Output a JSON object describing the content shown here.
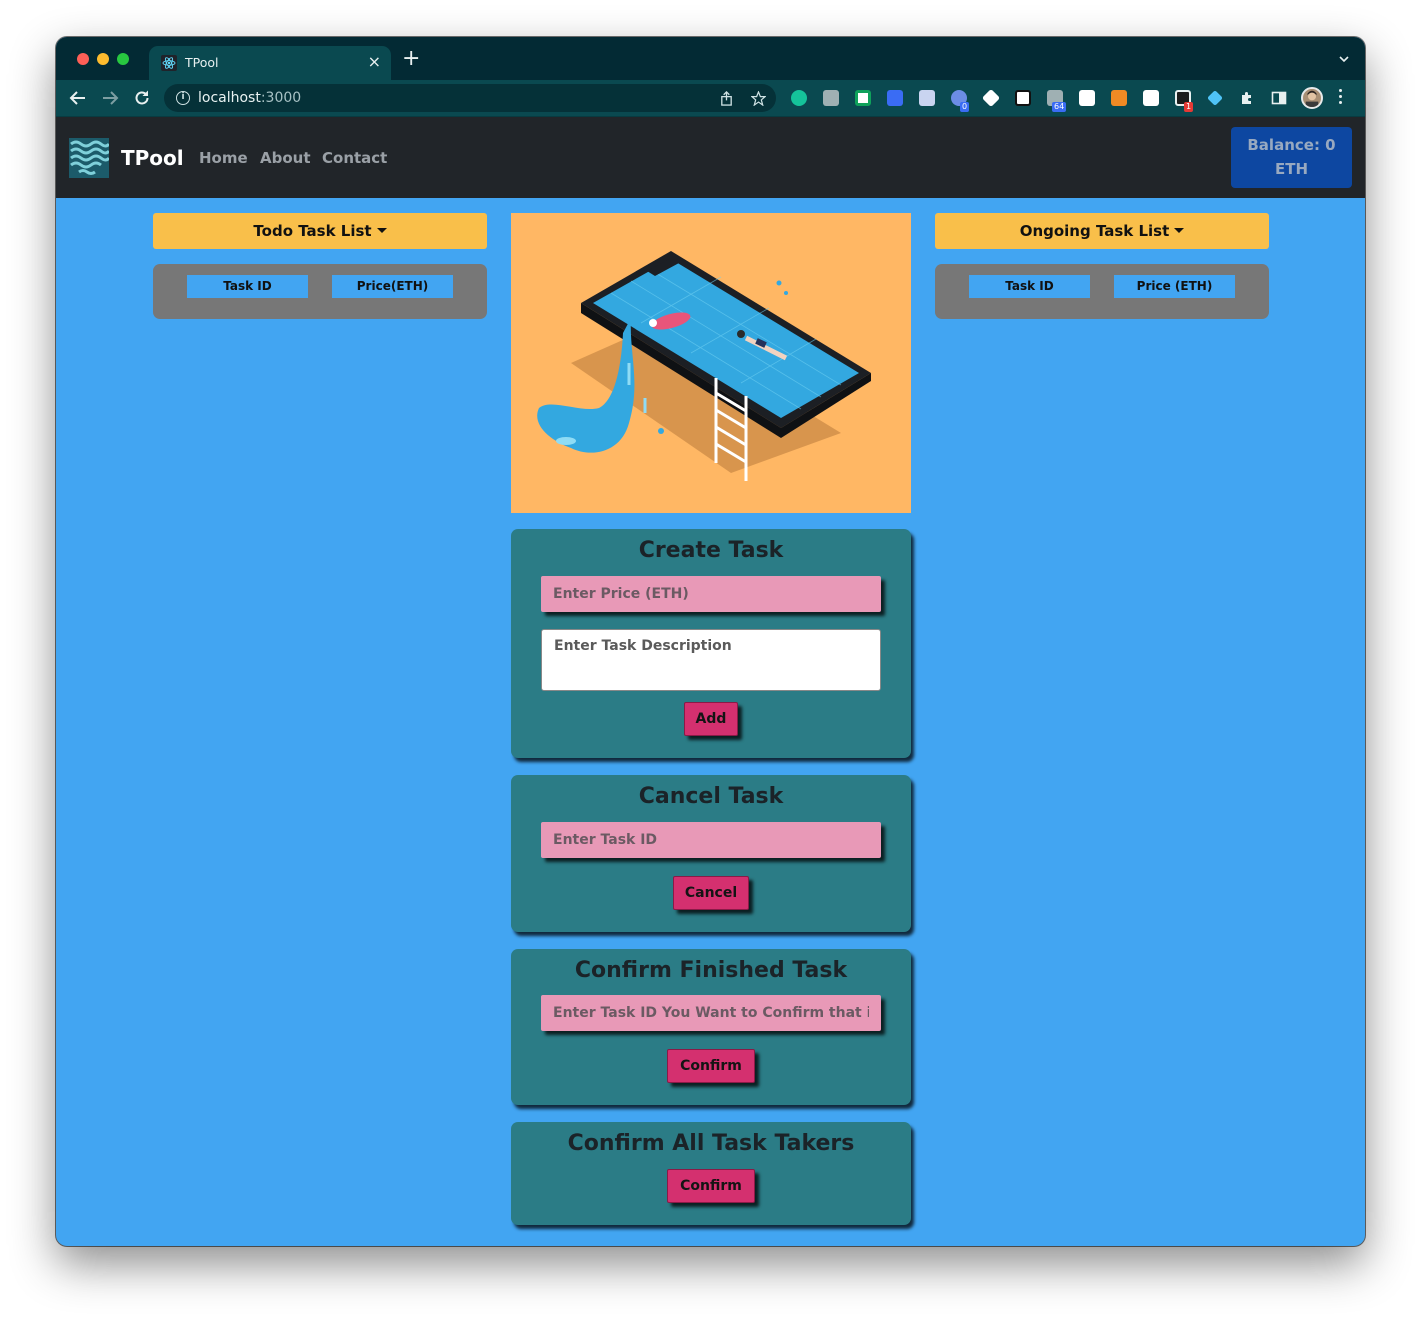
{
  "browser": {
    "tab_title": "TPool",
    "url_host": "localhost",
    "url_port": ":3000",
    "new_tab_symbol": "+",
    "close_symbol": "×",
    "extension_badges": {
      "todo": "0",
      "extension_64": "64",
      "notification": "1"
    }
  },
  "navbar": {
    "brand": "TPool",
    "links": [
      "Home",
      "About",
      "Contact"
    ],
    "balance_line1": "Balance: 0",
    "balance_line2": "ETH"
  },
  "todo_list": {
    "dropdown_label": "Todo Task List",
    "headers": [
      "Task ID",
      "Price(ETH)"
    ]
  },
  "ongoing_list": {
    "dropdown_label": "Ongoing Task List",
    "headers": [
      "Task ID",
      "Price (ETH)"
    ]
  },
  "create_task": {
    "title": "Create Task",
    "price_placeholder": "Enter Price (ETH)",
    "description_placeholder": "Enter Task Description",
    "button": "Add"
  },
  "cancel_task": {
    "title": "Cancel Task",
    "id_placeholder": "Enter Task ID",
    "button": "Cancel"
  },
  "confirm_finished": {
    "title": "Confirm Finished Task",
    "id_placeholder": "Enter Task ID You Want to Confirm that i",
    "button": "Confirm"
  },
  "confirm_takers": {
    "title": "Confirm All Task Takers",
    "button": "Confirm"
  },
  "colors": {
    "page_bg": "#42a5f2",
    "navbar_bg": "#212529",
    "balance_bg": "#0d47a1",
    "dropdown_bg": "#f9bf4a",
    "card_bg": "#2b7c86",
    "input_bg": "#e899b7",
    "button_bg": "#d4306f",
    "hero_bg": "#ffb764"
  }
}
